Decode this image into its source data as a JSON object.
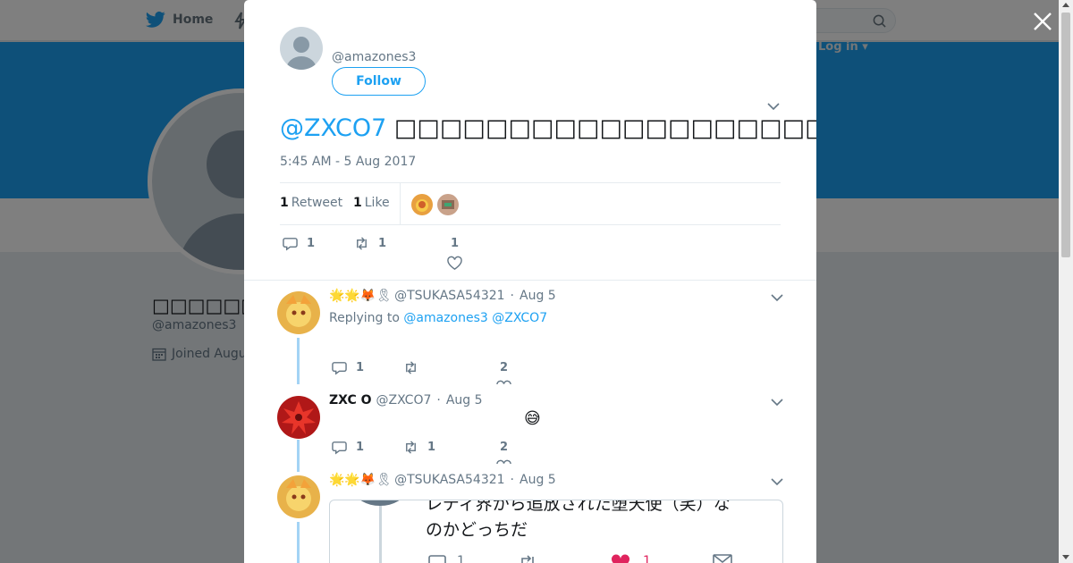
{
  "colors": {
    "accent": "#1da1f2",
    "like": "#e0245e",
    "text": "#14171a",
    "muted": "#657786"
  },
  "nav": {
    "home_label": "Home",
    "login_label": "Log in ▾",
    "home_icon": "bird-icon",
    "moments_icon": "bolt-icon",
    "search_icon": "search-icon"
  },
  "profile": {
    "name": "□□□□□□",
    "handle": "@amazones3",
    "joined": "Joined August"
  },
  "tweet": {
    "author_handle": "@amazones3",
    "follow_label": "Follow",
    "mention": "@ZXCO7",
    "text": "□□□□□□□□□□□□□□□□□□□□□□□□□□□□□□□□□□□□□□□□□□□□□□□□□□□",
    "timestamp": "5:45 AM - 5 Aug 2017",
    "retweets_count": "1",
    "retweets_label": "Retweet",
    "likes_count": "1",
    "likes_label": "Like",
    "actions": {
      "replies": "1",
      "retweets": "1",
      "likes": "1"
    }
  },
  "replies": [
    {
      "emoji": "🌟🌟🦊🎗",
      "handle": "@TSUKASA54321",
      "sep": "·",
      "date": "Aug 5",
      "replying_prefix": "Replying to",
      "replying_to": "@amazones3 @ZXCO7",
      "actions": {
        "replies": "1",
        "retweets": "",
        "likes": "2"
      }
    },
    {
      "name": "ZXC O",
      "handle": "@ZXCO7",
      "sep": "·",
      "date": "Aug 5",
      "text": "😅",
      "actions": {
        "replies": "1",
        "retweets": "1",
        "likes": "2"
      }
    },
    {
      "emoji": "🌟🌟🦊🎗",
      "handle": "@TSUKASA54321",
      "sep": "·",
      "date": "Aug 5",
      "quote_text": "レディ界から追放された堕天使（笑）な\nのかどっちだ",
      "quote_actions": {
        "replies": "1",
        "likes": "1"
      }
    }
  ]
}
